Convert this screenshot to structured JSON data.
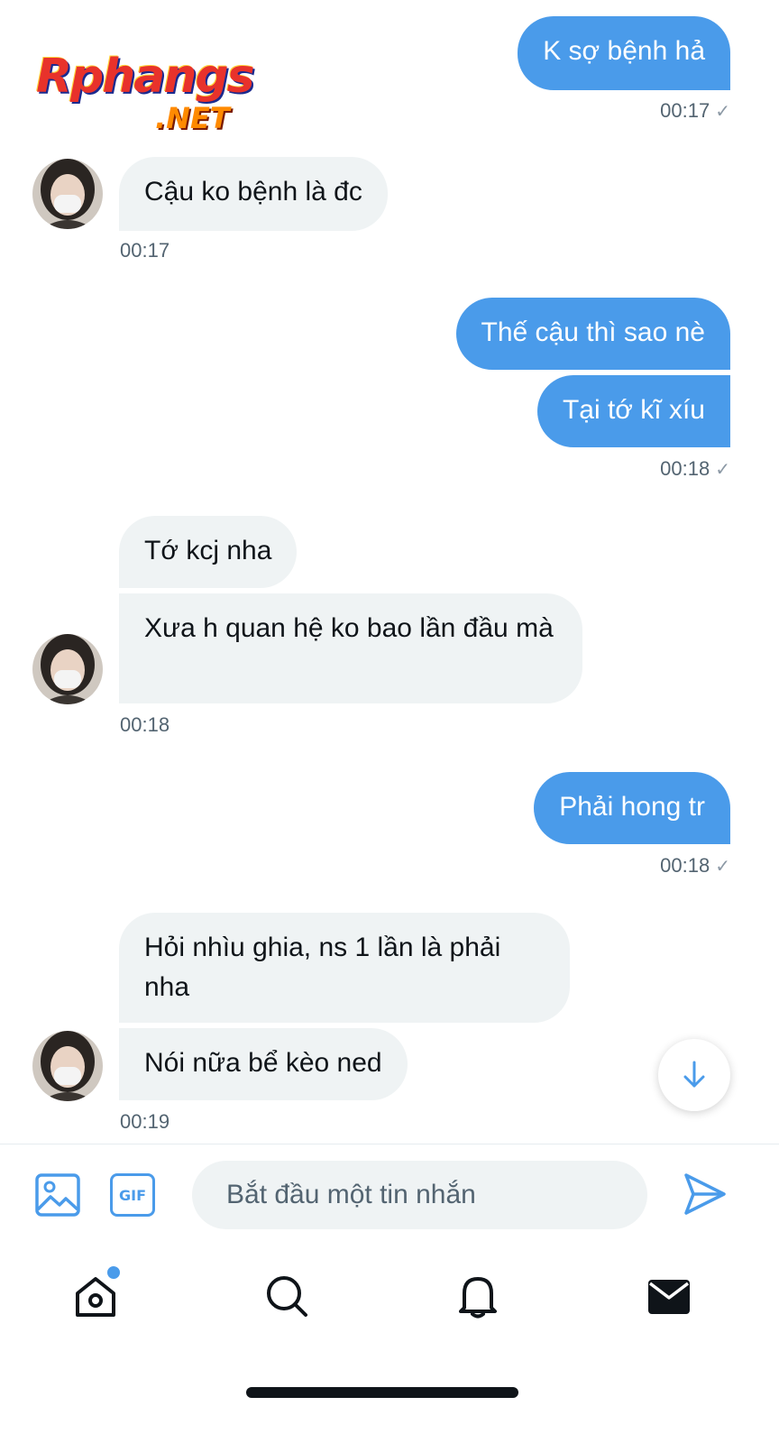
{
  "watermark": {
    "main": "Rphangs",
    "suffix": ".NET"
  },
  "messages": {
    "m1": {
      "text": "K sợ bệnh hả",
      "time": "00:17"
    },
    "m2": {
      "text": "Cậu ko bệnh là đc",
      "time": "00:17"
    },
    "m3": {
      "text": "Thế cậu thì sao nè"
    },
    "m4": {
      "text": "Tại tớ kĩ xíu",
      "time": "00:18"
    },
    "m5": {
      "text": "Tớ kcj nha"
    },
    "m6": {
      "text": "Xưa h quan hệ ko bao lần đầu mà",
      "time": "00:18"
    },
    "m7": {
      "text": "Phải hong tr",
      "time": "00:18"
    },
    "m8": {
      "text": "Hỏi nhìu ghia, ns 1 lần là phải nha"
    },
    "m9": {
      "text": "Nói nữa bể kèo ned",
      "time": "00:19"
    }
  },
  "status": {
    "check": "✓"
  },
  "composer": {
    "placeholder": "Bắt đầu một tin nhắn",
    "gif_label": "GIF"
  },
  "icons": {
    "image": "image-icon",
    "gif": "gif-icon",
    "send": "send-icon",
    "scroll_down": "arrow-down-icon",
    "home": "home-icon",
    "search": "search-icon",
    "notifications": "bell-icon",
    "messages": "mail-icon"
  },
  "colors": {
    "accent": "#4a9bea",
    "received_bubble": "#eff3f4",
    "muted_text": "#536471"
  }
}
